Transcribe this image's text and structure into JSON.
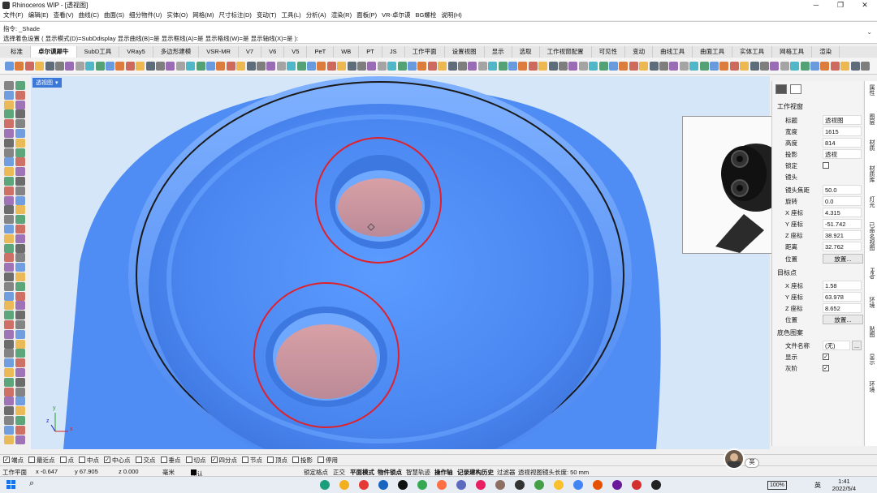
{
  "window": {
    "title": "Rhinoceros WIP - [透视图]",
    "minimize_icon": "minimize-icon",
    "maximize_icon": "maximize-icon",
    "close_icon": "close-icon"
  },
  "menu": [
    "文件(F)",
    "编辑(E)",
    "查看(V)",
    "曲线(C)",
    "曲面(S)",
    "细分物件(U)",
    "实体(O)",
    "网格(M)",
    "尺寸标注(D)",
    "变动(T)",
    "工具(L)",
    "分析(A)",
    "渲染(R)",
    "面板(P)",
    "VR-卓尔谟",
    "BG螺栓",
    "说明(H)"
  ],
  "command": {
    "history": "指令: _Shade",
    "prompt": "选择着色设置 ( 显示模式(D)=SubDdisplay  显示曲线(B)=是  显示框线(A)=是  显示格线(W)=是  显示轴线(X)=是 ):"
  },
  "tabs": [
    "标准",
    "卓尔谟犀牛",
    "SubD工具",
    "VRay5",
    "多边形建模",
    "VSR-MR",
    "V7",
    "V6",
    "V5",
    "PeT",
    "WB",
    "PT",
    "JS",
    "工作平面",
    "设置视图",
    "显示",
    "选取",
    "工作视窗配置",
    "可见性",
    "变动",
    "曲线工具",
    "曲面工具",
    "实体工具",
    "网格工具",
    "渲染"
  ],
  "active_tab": "卓尔谟犀牛",
  "viewport": {
    "label": "透视图",
    "axis_x": "x",
    "axis_y": "y",
    "axis_z": "z"
  },
  "panel": {
    "section_viewport": "工作视窗",
    "rows": [
      {
        "label": "标题",
        "value": "透视图"
      },
      {
        "label": "宽度",
        "value": "1615"
      },
      {
        "label": "高度",
        "value": "814"
      },
      {
        "label": "投影",
        "value": "透视"
      },
      {
        "label": "锁定",
        "value": ""
      },
      {
        "label": "镜头",
        "value": ""
      },
      {
        "label": "镜头焦距",
        "value": "50.0"
      },
      {
        "label": "旋转",
        "value": "0.0"
      },
      {
        "label": "X 座标",
        "value": "4.315"
      },
      {
        "label": "Y 座标",
        "value": "-51.742"
      },
      {
        "label": "Z 座标",
        "value": "38.921"
      },
      {
        "label": "距离",
        "value": "32.762"
      }
    ],
    "camera_location_label": "位置",
    "camera_location_button": "放置...",
    "section_target": "目标点",
    "target_rows": [
      {
        "label": "X 座标",
        "value": "1.58"
      },
      {
        "label": "Y 座标",
        "value": "63.978"
      },
      {
        "label": "Z 座标",
        "value": "8.652"
      }
    ],
    "target_location_label": "位置",
    "target_location_button": "放置...",
    "section_wallpaper": "底色图案",
    "wallpaper_rows": [
      {
        "label": "文件名称",
        "value": "(无)"
      },
      {
        "label": "显示",
        "value": "✓"
      },
      {
        "label": "灰阶",
        "value": "✓"
      }
    ],
    "browse_button": "..."
  },
  "side_tabs": [
    "属性",
    "图层",
    "材质",
    "材质库",
    "灯光",
    "已命名视图",
    "Help",
    "环境",
    "贴图",
    "显示",
    "环境"
  ],
  "snaps": [
    {
      "label": "端点",
      "checked": "✓"
    },
    {
      "label": "最近点",
      "checked": ""
    },
    {
      "label": "点",
      "checked": ""
    },
    {
      "label": "中点",
      "checked": ""
    },
    {
      "label": "中心点",
      "checked": "✓"
    },
    {
      "label": "交点",
      "checked": ""
    },
    {
      "label": "垂点",
      "checked": ""
    },
    {
      "label": "切点",
      "checked": ""
    },
    {
      "label": "四分点",
      "checked": "✓"
    },
    {
      "label": "节点",
      "checked": ""
    },
    {
      "label": "顶点",
      "checked": ""
    },
    {
      "label": "投影",
      "checked": ""
    },
    {
      "label": "停用",
      "checked": ""
    }
  ],
  "status": {
    "cplane": "工作平面",
    "x": "x -0.647",
    "y": "y 67.905",
    "z": "z 0.000",
    "unit": "毫米",
    "layer": "默认",
    "grid_snap": "锁定格点",
    "ortho": "正交",
    "planar": "平面模式",
    "osnap": "物件锁点",
    "smarttrack": "智慧轨迹",
    "gumball": "操作轴",
    "history": "记录建构历史",
    "filter": "过滤器",
    "message": "透视视图镜头长度: 50 mm"
  },
  "taskbar": {
    "time": "1:41",
    "date": "2022/5/4",
    "battery": "100%",
    "ime": "英",
    "webcam_badge": "英"
  },
  "colors": {
    "model_blue": "#4f8df5",
    "hole_pink": "#c9939c",
    "selection_red": "#e0202a",
    "viewport_bg": "#cfe3f6"
  }
}
